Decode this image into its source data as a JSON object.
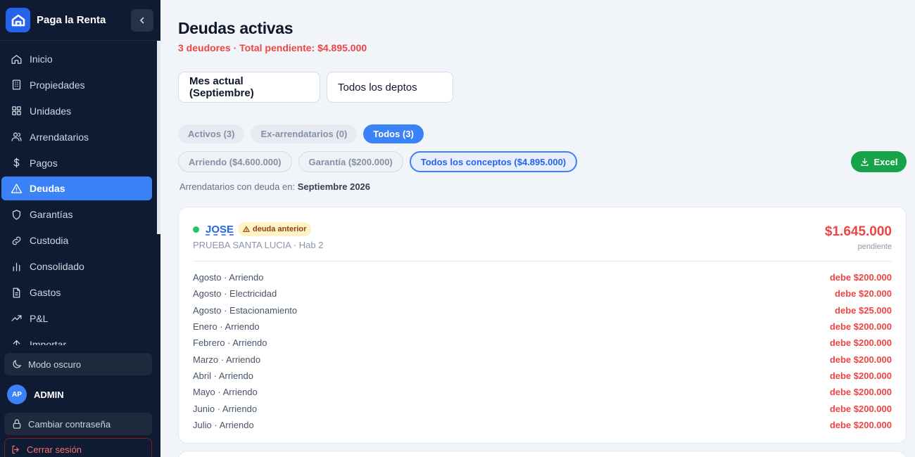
{
  "app": {
    "name": "Paga la Renta"
  },
  "sidebar": {
    "items": [
      {
        "label": "Inicio",
        "icon": "home-icon"
      },
      {
        "label": "Propiedades",
        "icon": "building-icon"
      },
      {
        "label": "Unidades",
        "icon": "grid-icon"
      },
      {
        "label": "Arrendatarios",
        "icon": "users-icon"
      },
      {
        "label": "Pagos",
        "icon": "dollar-icon"
      },
      {
        "label": "Deudas",
        "icon": "alert-icon",
        "active": true
      },
      {
        "label": "Garantías",
        "icon": "shield-icon"
      },
      {
        "label": "Custodia",
        "icon": "link-icon"
      },
      {
        "label": "Consolidado",
        "icon": "bar-chart-icon"
      },
      {
        "label": "Gastos",
        "icon": "file-icon"
      },
      {
        "label": "P&L",
        "icon": "trending-icon"
      },
      {
        "label": "Importar",
        "icon": "upload-icon"
      }
    ],
    "dark_mode": "Modo oscuro",
    "user": {
      "initials": "AP",
      "name": "ADMIN"
    },
    "change_password": "Cambiar contraseña",
    "logout": "Cerrar sesión"
  },
  "main": {
    "title": "Deudas activas",
    "summary": "3 deudores · Total pendiente: $4.895.000",
    "filters": {
      "month": "Mes actual (Septiembre)",
      "depto": "Todos los deptos"
    },
    "tabs": [
      {
        "label": "Activos (3)"
      },
      {
        "label": "Ex-arrendatarios (0)"
      },
      {
        "label": "Todos (3)",
        "selected": true
      }
    ],
    "concepts": [
      {
        "label": "Arriendo ($4.600.000)"
      },
      {
        "label": "Garantía ($200.000)"
      },
      {
        "label": "Todos los conceptos ($4.895.000)",
        "selected": true
      }
    ],
    "excel_label": "Excel",
    "period_prefix": "Arrendatarios con deuda en:",
    "period_value": "Septiembre 2026",
    "card": {
      "name": "JOSE",
      "badge": "deuda anterior",
      "location": "PRUEBA SANTA LUCIA · Hab 2",
      "total": "$1.645.000",
      "total_label": "pendiente",
      "lines": [
        {
          "concept": "Agosto · Arriendo",
          "amount": "debe $200.000"
        },
        {
          "concept": "Agosto · Electricidad",
          "amount": "debe $20.000"
        },
        {
          "concept": "Agosto · Estacionamiento",
          "amount": "debe $25.000"
        },
        {
          "concept": "Enero · Arriendo",
          "amount": "debe $200.000"
        },
        {
          "concept": "Febrero · Arriendo",
          "amount": "debe $200.000"
        },
        {
          "concept": "Marzo · Arriendo",
          "amount": "debe $200.000"
        },
        {
          "concept": "Abril · Arriendo",
          "amount": "debe $200.000"
        },
        {
          "concept": "Mayo · Arriendo",
          "amount": "debe $200.000"
        },
        {
          "concept": "Junio · Arriendo",
          "amount": "debe $200.000"
        },
        {
          "concept": "Julio · Arriendo",
          "amount": "debe $200.000"
        }
      ]
    }
  },
  "colors": {
    "accent": "#3b82f6",
    "danger": "#ef4444",
    "success": "#16a34a",
    "sidebar": "#0f1a33"
  }
}
